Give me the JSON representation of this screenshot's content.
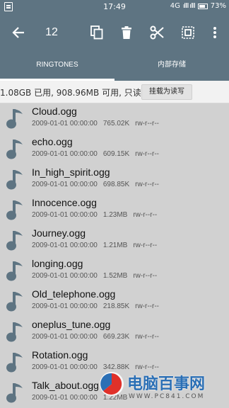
{
  "status_bar": {
    "time": "17:49",
    "network": "4G",
    "signal": "ıllll ıllll",
    "battery": "73%"
  },
  "toolbar": {
    "selected_count": "12",
    "icons": [
      "back-arrow-icon",
      "copy-icon",
      "delete-icon",
      "cut-icon",
      "select-all-icon",
      "more-vert-icon"
    ]
  },
  "tabs": [
    {
      "label": "RINGTONES",
      "active": true
    },
    {
      "label": "内部存储",
      "active": false
    }
  ],
  "storage": {
    "info": "1.08GB 已用, 908.96MB 可用, 只读",
    "remount_label": "挂载为读写"
  },
  "files": [
    {
      "name": "Cloud.ogg",
      "date": "2009-01-01 00:00:00",
      "size": "765.02K",
      "perm": "rw-r--r--"
    },
    {
      "name": "echo.ogg",
      "date": "2009-01-01 00:00:00",
      "size": "609.15K",
      "perm": "rw-r--r--"
    },
    {
      "name": "In_high_spirit.ogg",
      "date": "2009-01-01 00:00:00",
      "size": "698.85K",
      "perm": "rw-r--r--"
    },
    {
      "name": "Innocence.ogg",
      "date": "2009-01-01 00:00:00",
      "size": "1.23MB",
      "perm": "rw-r--r--"
    },
    {
      "name": "Journey.ogg",
      "date": "2009-01-01 00:00:00",
      "size": "1.21MB",
      "perm": "rw-r--r--"
    },
    {
      "name": "longing.ogg",
      "date": "2009-01-01 00:00:00",
      "size": "1.52MB",
      "perm": "rw-r--r--"
    },
    {
      "name": "Old_telephone.ogg",
      "date": "2009-01-01 00:00:00",
      "size": "218.85K",
      "perm": "rw-r--r--"
    },
    {
      "name": "oneplus_tune.ogg",
      "date": "2009-01-01 00:00:00",
      "size": "669.23K",
      "perm": "rw-r--r--"
    },
    {
      "name": "Rotation.ogg",
      "date": "2009-01-01 00:00:00",
      "size": "342.88K",
      "perm": "rw-r--r--"
    },
    {
      "name": "Talk_about.ogg",
      "date": "2009-01-01 00:00:00",
      "size": "1.22MB",
      "perm": ""
    }
  ],
  "watermark": {
    "text": "电脑百事网",
    "url": "WWW.PC841.COM"
  },
  "colors": {
    "toolbar": "#5e7482",
    "list_bg": "#d1d1d1",
    "icon": "#5e7482"
  }
}
